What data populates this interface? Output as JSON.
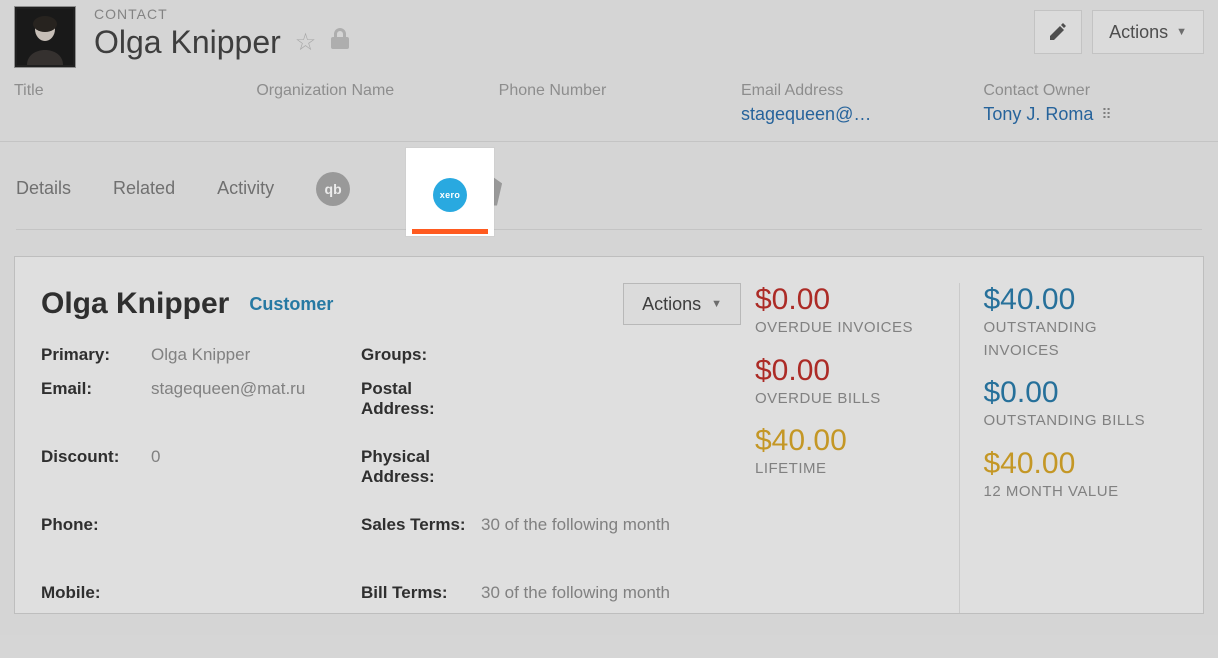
{
  "header": {
    "eyebrow": "CONTACT",
    "name": "Olga Knipper",
    "edit_btn": "",
    "actions_btn": "Actions"
  },
  "info": {
    "title_label": "Title",
    "title_value": "",
    "org_label": "Organization Name",
    "org_value": "",
    "phone_label": "Phone Number",
    "phone_value": "",
    "email_label": "Email Address",
    "email_value": "stagequeen@…",
    "owner_label": "Contact Owner",
    "owner_value": "Tony J. Roma"
  },
  "tabs": {
    "details": "Details",
    "related": "Related",
    "activity": "Activity"
  },
  "panel": {
    "title": "Olga Knipper",
    "badge": "Customer",
    "actions": "Actions",
    "labels": {
      "primary": "Primary:",
      "email": "Email:",
      "discount": "Discount:",
      "phone": "Phone:",
      "mobile": "Mobile:",
      "groups": "Groups:",
      "postal": "Postal Address:",
      "physical": "Physical Address:",
      "sales_terms": "Sales Terms:",
      "bill_terms": "Bill Terms:"
    },
    "values": {
      "primary": "Olga Knipper",
      "email": "stagequeen@mat.ru",
      "discount": "0",
      "phone": "",
      "mobile": "",
      "groups": "",
      "postal": "",
      "physical": "",
      "sales_terms": "30 of the following month",
      "bill_terms": "30 of the following month"
    }
  },
  "stats": {
    "left": [
      {
        "value": "$0.00",
        "label": "OVERDUE INVOICES",
        "color": "red"
      },
      {
        "value": "$0.00",
        "label": "OVERDUE BILLS",
        "color": "red"
      },
      {
        "value": "$40.00",
        "label": "LIFETIME",
        "color": "gold"
      }
    ],
    "right": [
      {
        "value": "$40.00",
        "label": "OUTSTANDING INVOICES",
        "color": "blue"
      },
      {
        "value": "$0.00",
        "label": "OUTSTANDING BILLS",
        "color": "blue"
      },
      {
        "value": "$40.00",
        "label": "12 MONTH VALUE",
        "color": "gold"
      }
    ]
  }
}
